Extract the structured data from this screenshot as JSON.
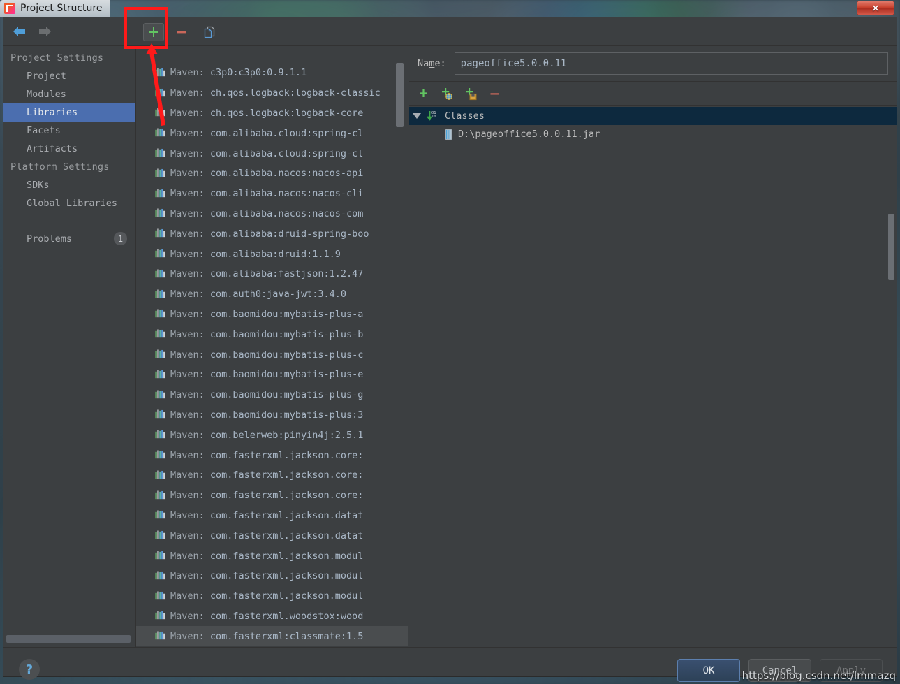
{
  "window": {
    "title": "Project Structure",
    "app_icon": "intellij-idea-icon",
    "close_label": "✕"
  },
  "toolbar": {
    "back_icon": "back-arrow-icon",
    "forward_icon": "forward-arrow-icon",
    "add_icon": "plus-icon",
    "remove_icon": "minus-icon",
    "copy_icon": "copy-icon"
  },
  "sidebar": {
    "groups": [
      {
        "label": "Project Settings",
        "items": [
          {
            "label": "Project",
            "selected": false
          },
          {
            "label": "Modules",
            "selected": false
          },
          {
            "label": "Libraries",
            "selected": true
          },
          {
            "label": "Facets",
            "selected": false
          },
          {
            "label": "Artifacts",
            "selected": false
          }
        ]
      },
      {
        "label": "Platform Settings",
        "items": [
          {
            "label": "SDKs",
            "selected": false
          },
          {
            "label": "Global Libraries",
            "selected": false
          }
        ]
      }
    ],
    "problems": {
      "label": "Problems",
      "count": "1"
    }
  },
  "library_list": {
    "prefix": "Maven: ",
    "items": [
      "c3p0:c3p0:0.9.1.1",
      "ch.qos.logback:logback-classic",
      "ch.qos.logback:logback-core",
      "com.alibaba.cloud:spring-cl",
      "com.alibaba.cloud:spring-cl",
      "com.alibaba.nacos:nacos-api",
      "com.alibaba.nacos:nacos-cli",
      "com.alibaba.nacos:nacos-com",
      "com.alibaba:druid-spring-boo",
      "com.alibaba:druid:1.1.9",
      "com.alibaba:fastjson:1.2.47",
      "com.auth0:java-jwt:3.4.0",
      "com.baomidou:mybatis-plus-a",
      "com.baomidou:mybatis-plus-b",
      "com.baomidou:mybatis-plus-c",
      "com.baomidou:mybatis-plus-e",
      "com.baomidou:mybatis-plus-g",
      "com.baomidou:mybatis-plus:3",
      "com.belerweb:pinyin4j:2.5.1",
      "com.fasterxml.jackson.core:",
      "com.fasterxml.jackson.core:",
      "com.fasterxml.jackson.core:",
      "com.fasterxml.jackson.datat",
      "com.fasterxml.jackson.datat",
      "com.fasterxml.jackson.modul",
      "com.fasterxml.jackson.modul",
      "com.fasterxml.jackson.modul",
      "com.fasterxml.woodstox:wood",
      "com.fasterxml:classmate:1.5"
    ]
  },
  "detail": {
    "name_label_pre": "Na",
    "name_label_mnemonic": "m",
    "name_label_post": "e:",
    "name_value": "pageoffice5.0.0.11",
    "name_placeholder": "",
    "toolbar": {
      "add_icon": "plus-icon",
      "add_url_icon": "plus-globe-icon",
      "add_jar_icon": "plus-jar-icon",
      "remove_icon": "minus-icon"
    },
    "tree": {
      "root": {
        "label": "Classes",
        "icon": "classes-icon",
        "expanded": true
      },
      "children": [
        {
          "label": "D:\\pageoffice5.0.0.11.jar",
          "icon": "jar-file-icon"
        }
      ]
    }
  },
  "footer": {
    "help_label": "?",
    "ok_label": "OK",
    "cancel_label": "Cancel",
    "apply_label": "Apply"
  },
  "watermark": "https://blog.csdn.net/lmmazq",
  "colors": {
    "accent_selected": "#4b6eaf",
    "tree_selected": "#0d293e",
    "panel_bg": "#3c3f41",
    "text": "#a9b7c6",
    "annotation": "#ff1a1a",
    "ok_border": "#5c7fae"
  }
}
